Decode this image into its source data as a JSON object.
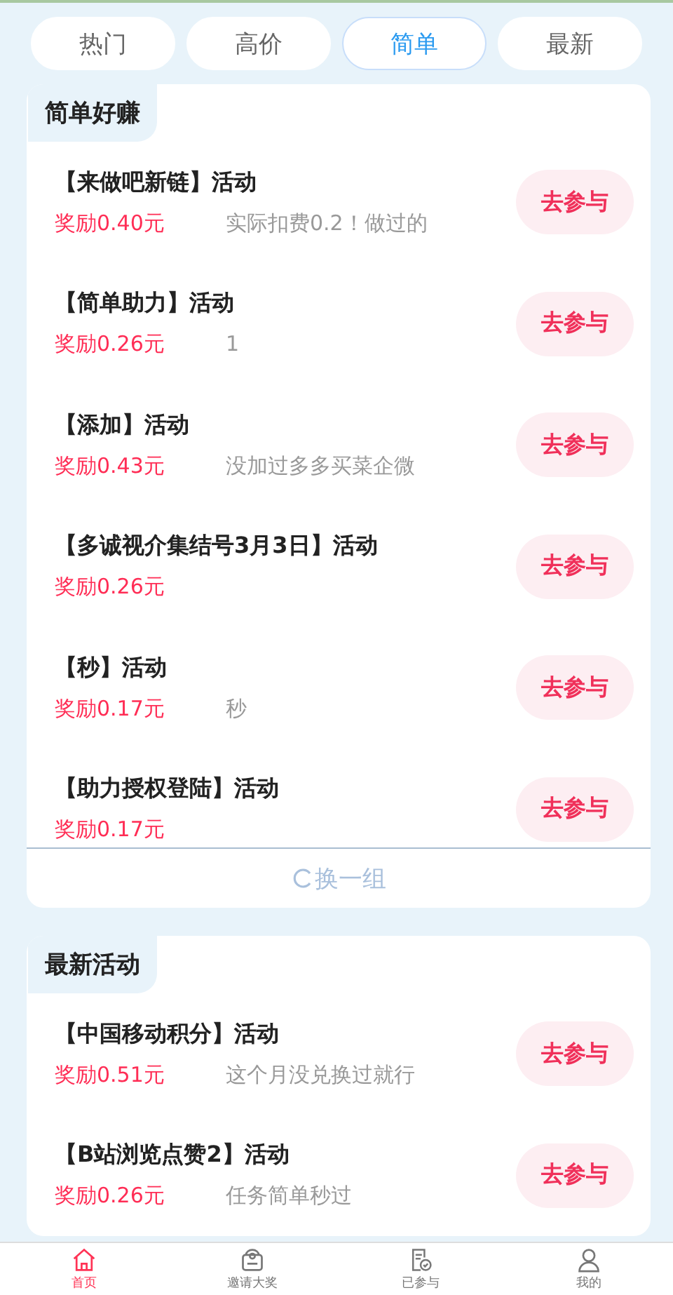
{
  "tabs": [
    {
      "label": "热门",
      "selected": false
    },
    {
      "label": "高价",
      "selected": false
    },
    {
      "label": "简单",
      "selected": true
    },
    {
      "label": "最新",
      "selected": false
    }
  ],
  "sections": [
    {
      "title": "简单好赚",
      "refresh": "换一组",
      "items": [
        {
          "title": "【来做吧新链】活动",
          "reward": "奖励0.40元",
          "note": "实际扣费0.2！做过的",
          "action": "去参与"
        },
        {
          "title": "【简单助力】活动",
          "reward": "奖励0.26元",
          "note": "1",
          "action": "去参与"
        },
        {
          "title": "【添加】活动",
          "reward": "奖励0.43元",
          "note": "没加过多多买菜企微",
          "action": "去参与"
        },
        {
          "title": "【多诚视介集结号3月3日】活动",
          "reward": "奖励0.26元",
          "action": "去参与"
        },
        {
          "title": "【秒】活动",
          "reward": "奖励0.17元",
          "note": "秒",
          "action": "去参与"
        },
        {
          "title": "【助力授权登陆】活动",
          "reward": "奖励0.17元",
          "action": "去参与"
        }
      ]
    },
    {
      "title": "最新活动",
      "items": [
        {
          "title": "【中国移动积分】活动",
          "reward": "奖励0.51元",
          "note": "这个月没兑换过就行",
          "action": "去参与"
        },
        {
          "title": "【B站浏览点赞2】活动",
          "reward": "奖励0.26元",
          "note": "任务简单秒过",
          "action": "去参与"
        }
      ]
    }
  ],
  "nav": [
    {
      "kind": "home",
      "label": "首页",
      "selected": true
    },
    {
      "kind": "gift",
      "label": "邀请大奖",
      "selected": false
    },
    {
      "kind": "joined",
      "label": "已参与",
      "selected": false
    },
    {
      "kind": "user",
      "label": "我的",
      "selected": false
    }
  ]
}
